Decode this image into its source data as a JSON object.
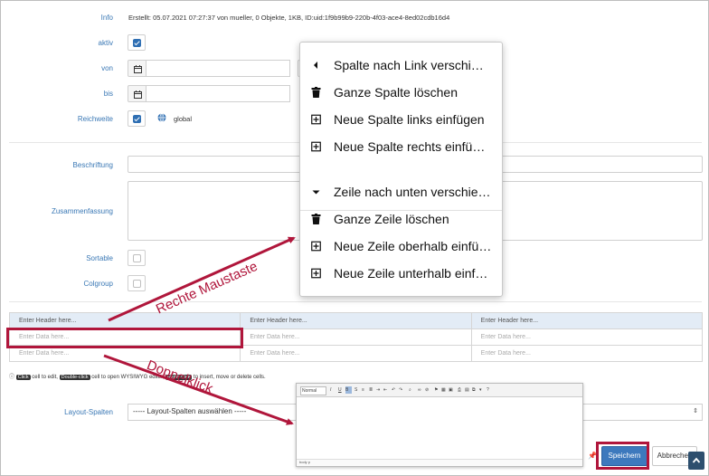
{
  "form": {
    "info_label": "Info",
    "info_text": "Erstellt: 05.07.2021 07:27:37 von mueller, 0 Objekte, 1KB, ID:uid:1f9b99b9-220b-4f03-ace4-8ed02cdb16d4",
    "aktiv_label": "aktiv",
    "von_label": "von",
    "bis_label": "bis",
    "reichweite_label": "Reichweite",
    "reichweite_value": "global",
    "beschriftung_label": "Beschriftung",
    "zusammenfassung_label": "Zusammenfassung",
    "sortable_label": "Sortable",
    "colgroup_label": "Colgroup",
    "layout_label": "Layout-Spalten",
    "layout_select": "----- Layout-Spalten auswählen -----"
  },
  "grid": {
    "header": [
      "Enter Header here...",
      "Enter Header here...",
      "Enter Header here..."
    ],
    "rows": [
      [
        "Enter Data here...",
        "Enter Data here...",
        "Enter Data here..."
      ],
      [
        "Enter Data here...",
        "Enter Data here...",
        "Enter Data here..."
      ]
    ]
  },
  "hint": {
    "click": "Click",
    "t1": " cell to edit, ",
    "dblclick": "Double-click",
    "t2": " cell to open WYSIWYG editor, ",
    "rightclick": "Right-click",
    "t3": " to insert, move or delete cells."
  },
  "context_menu": {
    "items": [
      {
        "label": "Spalte nach Link verschi…",
        "icon": "caret-left-icon"
      },
      {
        "label": "Ganze Spalte löschen",
        "icon": "trash-icon"
      },
      {
        "label": "Neue Spalte links einfügen",
        "icon": "plus-square-icon"
      },
      {
        "label": "Neue Spalte rechts einfü…",
        "icon": "plus-square-icon"
      },
      {
        "label": "Zeile nach unten verschie…",
        "icon": "caret-down-icon"
      },
      {
        "label": "Ganze Zeile löschen",
        "icon": "trash-icon"
      },
      {
        "label": "Neue Zeile oberhalb einfü…",
        "icon": "plus-square-icon"
      },
      {
        "label": "Neue Zeile unterhalb einf…",
        "icon": "plus-square-icon"
      }
    ]
  },
  "editor": {
    "format": "Normal",
    "status": "body  p"
  },
  "buttons": {
    "save": "Speichern",
    "cancel": "Abbrechen"
  },
  "annotations": {
    "right_click": "Rechte Maustaste",
    "double_click": "Doppelklick"
  },
  "colors": {
    "accent": "#2f6fb3",
    "highlight": "#b0163b",
    "label": "#3a78b5"
  }
}
